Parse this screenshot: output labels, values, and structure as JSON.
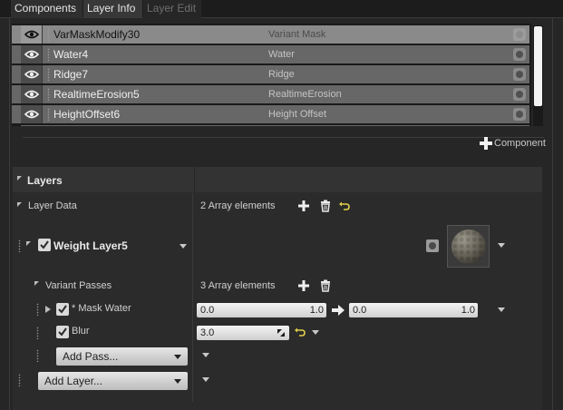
{
  "tabs": [
    {
      "label": "Components",
      "state": "normal"
    },
    {
      "label": "Layer Info",
      "state": "active"
    },
    {
      "label": "Layer Edit",
      "state": "disabled"
    }
  ],
  "components": [
    {
      "name": "VarMaskModify30",
      "type": "Variant Mask",
      "selected": true
    },
    {
      "name": "Water4",
      "type": "Water",
      "selected": false
    },
    {
      "name": "Ridge7",
      "type": "Ridge",
      "selected": false
    },
    {
      "name": "RealtimeErosion5",
      "type": "RealtimeErosion",
      "selected": false
    },
    {
      "name": "HeightOffset6",
      "type": "Height Offset",
      "selected": false
    }
  ],
  "add_component_label": "Component",
  "layers": {
    "title": "Layers",
    "layer_data_label": "Layer Data",
    "layer_data_count": "2 Array elements",
    "layer_name": "Weight Layer5",
    "layer_enabled": true,
    "variant_passes_label": "Variant Passes",
    "variant_passes_count": "3 Array elements",
    "passes": [
      {
        "label": "* Mask Water",
        "enabled": true,
        "range_a": {
          "min": "0.0",
          "max": "1.0"
        },
        "range_b": {
          "min": "0.0",
          "max": "1.0"
        }
      },
      {
        "label": "Blur",
        "enabled": true,
        "value": "3.0"
      }
    ],
    "add_pass_label": "Add Pass...",
    "add_layer_label": "Add Layer..."
  },
  "colors": {
    "accent_reset": "#e3d04a",
    "selected_row": "#8a8a8a",
    "row": "#676767"
  }
}
